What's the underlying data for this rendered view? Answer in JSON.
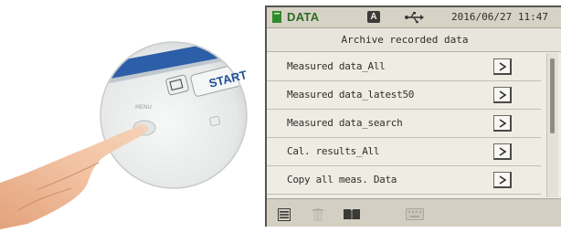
{
  "status_bar": {
    "mode_label": "DATA",
    "auto_badge": "A",
    "datetime": "2016/06/27 11:47",
    "accent_color": "#2f6c24"
  },
  "screen_title": "Archive recorded data",
  "menu": {
    "items": [
      {
        "label": "Measured data_All",
        "arrow": ">"
      },
      {
        "label": "Measured data_latest50",
        "arrow": ">"
      },
      {
        "label": "Measured data_search",
        "arrow": ">"
      },
      {
        "label": "Cal. results_All",
        "arrow": ">"
      },
      {
        "label": "Copy all meas. Data",
        "arrow": ">"
      }
    ]
  },
  "toolbar": {
    "icons": [
      "list-icon",
      "trash-icon",
      "book-icon",
      "keyboard-icon"
    ]
  },
  "illustration": {
    "start_label": "START"
  }
}
